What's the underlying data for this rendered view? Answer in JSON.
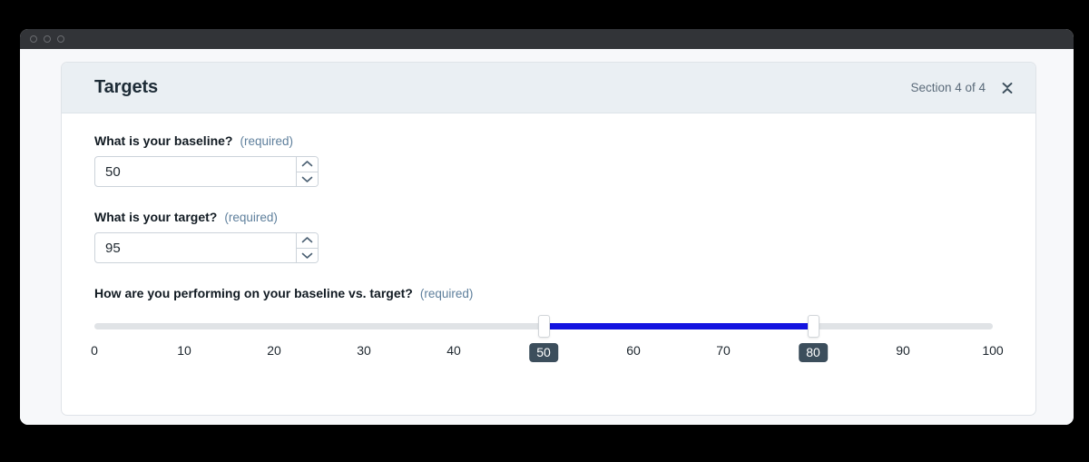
{
  "window": {
    "traffic_lights": [
      "close",
      "minimize",
      "maximize"
    ]
  },
  "card": {
    "title": "Targets",
    "section_counter": "Section 4 of 4",
    "collapse_icon": "collapse-icon"
  },
  "fields": [
    {
      "label": "What is your baseline?",
      "required_tag": "(required)",
      "value": "50",
      "placeholder": "",
      "type": "number"
    },
    {
      "label": "What is your target?",
      "required_tag": "(required)",
      "value": "95",
      "placeholder": "",
      "type": "number"
    }
  ],
  "slider": {
    "label": "How are you performing on your baseline vs. target?",
    "required_tag": "(required)",
    "min": 0,
    "max": 100,
    "lower_value": 50,
    "upper_value": 80,
    "lower_badge": "50",
    "upper_badge": "80",
    "ticks": [
      {
        "value": 0,
        "label": "0"
      },
      {
        "value": 10,
        "label": "10"
      },
      {
        "value": 20,
        "label": "20"
      },
      {
        "value": 30,
        "label": "30"
      },
      {
        "value": 40,
        "label": "40"
      },
      {
        "value": 50,
        "label": "50"
      },
      {
        "value": 60,
        "label": "60"
      },
      {
        "value": 70,
        "label": "70"
      },
      {
        "value": 80,
        "label": "80"
      },
      {
        "value": 90,
        "label": "90"
      },
      {
        "value": 100,
        "label": "100"
      }
    ],
    "hidden_tick_values": [
      50,
      80
    ],
    "colors": {
      "fill": "#1414e0",
      "track": "#e0e3e6",
      "badge": "#3c4e5c"
    }
  },
  "colors": {
    "page_background": "#000000",
    "viewport": "#f7f8fa",
    "titlebar": "#323438",
    "card_header": "#eaeff3",
    "required_text": "#5e7f9c"
  }
}
